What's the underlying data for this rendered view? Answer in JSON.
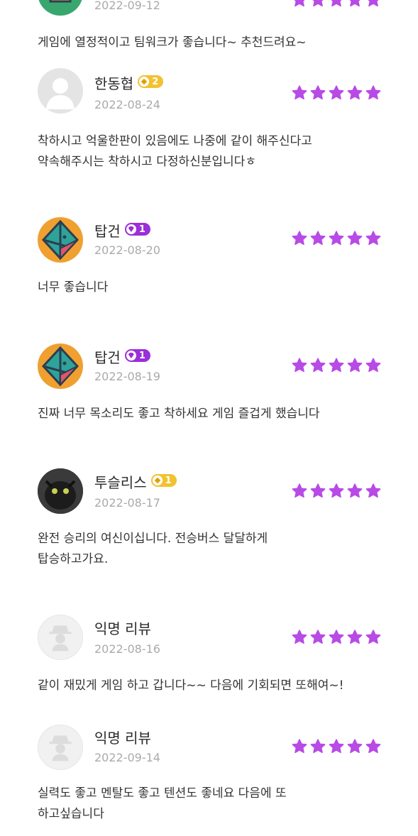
{
  "colors": {
    "star": "#b84ae6",
    "date": "#aaaaaa",
    "gold_badge": "#f2c230",
    "purple_badge": "#9b2fd9"
  },
  "reviews": [
    {
      "name": "",
      "badge": "",
      "date": "2022-09-12",
      "rating": 5,
      "avatar": "box-avatar",
      "text": [
        "게임에 열정적이고 팀워크가 좋습니다~ 추천드려요~"
      ]
    },
    {
      "name": "한동협",
      "badge": "2",
      "date": "2022-08-24",
      "rating": 5,
      "avatar": "default-user-avatar",
      "text": [
        "착하시고 억울한판이 있음에도 나중에 같이 해주신다고",
        "약속해주시는 착하시고 다정하신분입니다ㅎ"
      ]
    },
    {
      "name": "탑건",
      "badge": "1",
      "date": "2022-08-20",
      "rating": 5,
      "avatar": "diamond-avatar",
      "text": [
        "너무 좋습니다"
      ]
    },
    {
      "name": "탑건",
      "badge": "1",
      "date": "2022-08-19",
      "rating": 5,
      "avatar": "diamond-avatar",
      "text": [
        "진짜 너무 목소리도 좋고 착하세요 게임 즐겁게 했습니다"
      ]
    },
    {
      "name": "투슬리스",
      "badge": "1",
      "date": "2022-08-17",
      "rating": 5,
      "avatar": "dragon-avatar",
      "text": [
        "완전 승리의 여신이십니다. 전승버스 달달하게",
        "탑승하고가요."
      ]
    },
    {
      "name": "익명 리뷰",
      "badge": "",
      "date": "2022-08-16",
      "rating": 5,
      "avatar": "anonymous-avatar",
      "text": [
        "같이 재밌게 게임 하고 갑니다~~ 다음에 기회되면 또해여~!"
      ]
    },
    {
      "name": "익명 리뷰",
      "badge": "",
      "date": "2022-09-14",
      "rating": 5,
      "avatar": "anonymous-avatar",
      "text": [
        "실력도 좋고 멘탈도 좋고 텐션도 좋네요 다음에 또",
        "하고싶습니다"
      ]
    }
  ]
}
